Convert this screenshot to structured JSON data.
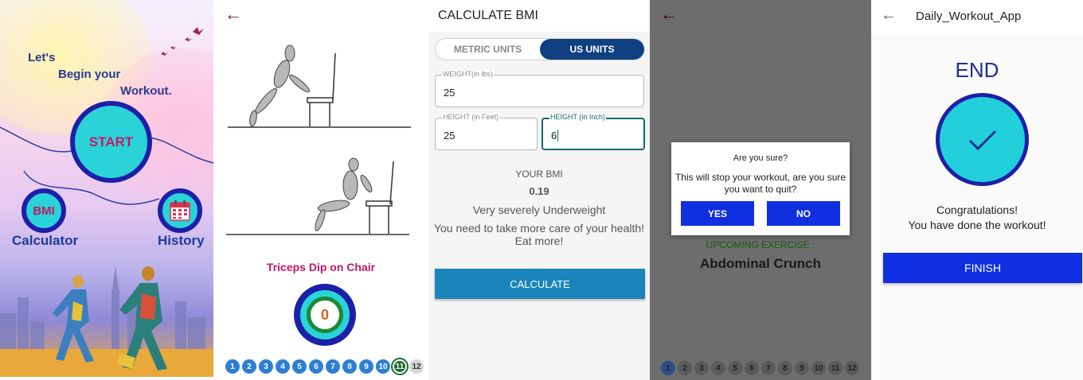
{
  "home": {
    "motto_line1": "Let's",
    "motto_line2": "Begin your",
    "motto_line3": "Workout.",
    "start_label": "START",
    "bmi_label": "BMI",
    "calculator_label": "Calculator",
    "history_label": "History",
    "accent_color": "#2ad3d8",
    "ring_color": "#1e1fa8"
  },
  "exercise": {
    "title": "Triceps Dip on Chair",
    "timer_value": "0",
    "steps": [
      "1",
      "2",
      "3",
      "4",
      "5",
      "6",
      "7",
      "8",
      "9",
      "10",
      "11",
      "12"
    ],
    "completed_steps": 10,
    "current_step": 11
  },
  "bmi": {
    "title": "CALCULATE BMI",
    "metric_label": "METRIC UNITS",
    "us_label": "US UNITS",
    "selected_unit": "US UNITS",
    "weight_label": "WEIGHT(in lbs)",
    "weight_value": "25",
    "height_feet_label": "HEIGHT (in Feet)",
    "height_feet_value": "25",
    "height_inch_label": "HEIGHT (in Inch)",
    "height_inch_value": "6",
    "your_bmi_label": "YOUR BMI",
    "bmi_value": "0.19",
    "bmi_category": "Very severely Underweight",
    "bmi_advice": "You need to take more care of your health! Eat more!",
    "calculate_label": "CALCULATE"
  },
  "quit_dialog": {
    "title": "Are you sure?",
    "message": "This will stop your workout, are you sure you want to quit?",
    "yes_label": "YES",
    "no_label": "NO",
    "upcoming_label": "UPCOMING EXERCISE :",
    "upcoming_name": "Abdominal Crunch",
    "steps": [
      "1",
      "2",
      "3",
      "4",
      "5",
      "6",
      "7",
      "8",
      "9",
      "10",
      "11",
      "12"
    ],
    "current_step": 1
  },
  "end": {
    "app_title": "Daily_Workout_App",
    "end_label": "END",
    "congrats_line1": "Congratulations!",
    "congrats_line2": "You have done the workout!",
    "finish_label": "FINISH"
  }
}
